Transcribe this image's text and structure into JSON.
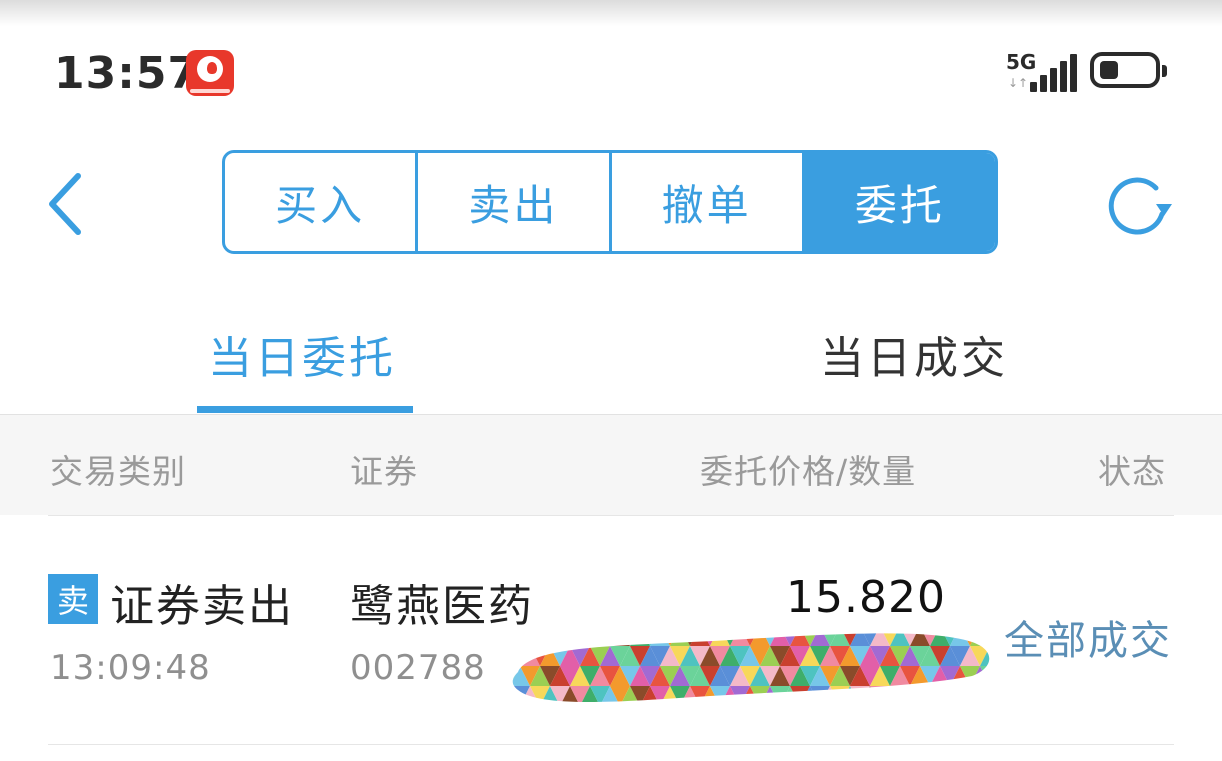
{
  "status_bar": {
    "time": "13:57",
    "network": "5G",
    "network_arrows": "↓↑"
  },
  "header": {
    "segments": [
      {
        "label": "买入",
        "active": false
      },
      {
        "label": "卖出",
        "active": false
      },
      {
        "label": "撤单",
        "active": false
      },
      {
        "label": "委托",
        "active": true
      }
    ]
  },
  "tabs": [
    {
      "label": "当日委托",
      "active": true
    },
    {
      "label": "当日成交",
      "active": false
    }
  ],
  "table": {
    "columns": [
      "交易类别",
      "证券",
      "委托价格/数量",
      "状态"
    ],
    "rows": [
      {
        "badge": "卖",
        "type": "证券卖出",
        "time": "13:09:48",
        "name": "鹭燕医药",
        "code": "002788",
        "price": "15.820",
        "status": "全部成交"
      }
    ]
  },
  "colors": {
    "accent": "#3a9ee0",
    "status_text": "#5a8eb5",
    "app_icon": "#e8382b"
  },
  "icons": {
    "back": "chevron-left-icon",
    "refresh": "refresh-icon"
  }
}
